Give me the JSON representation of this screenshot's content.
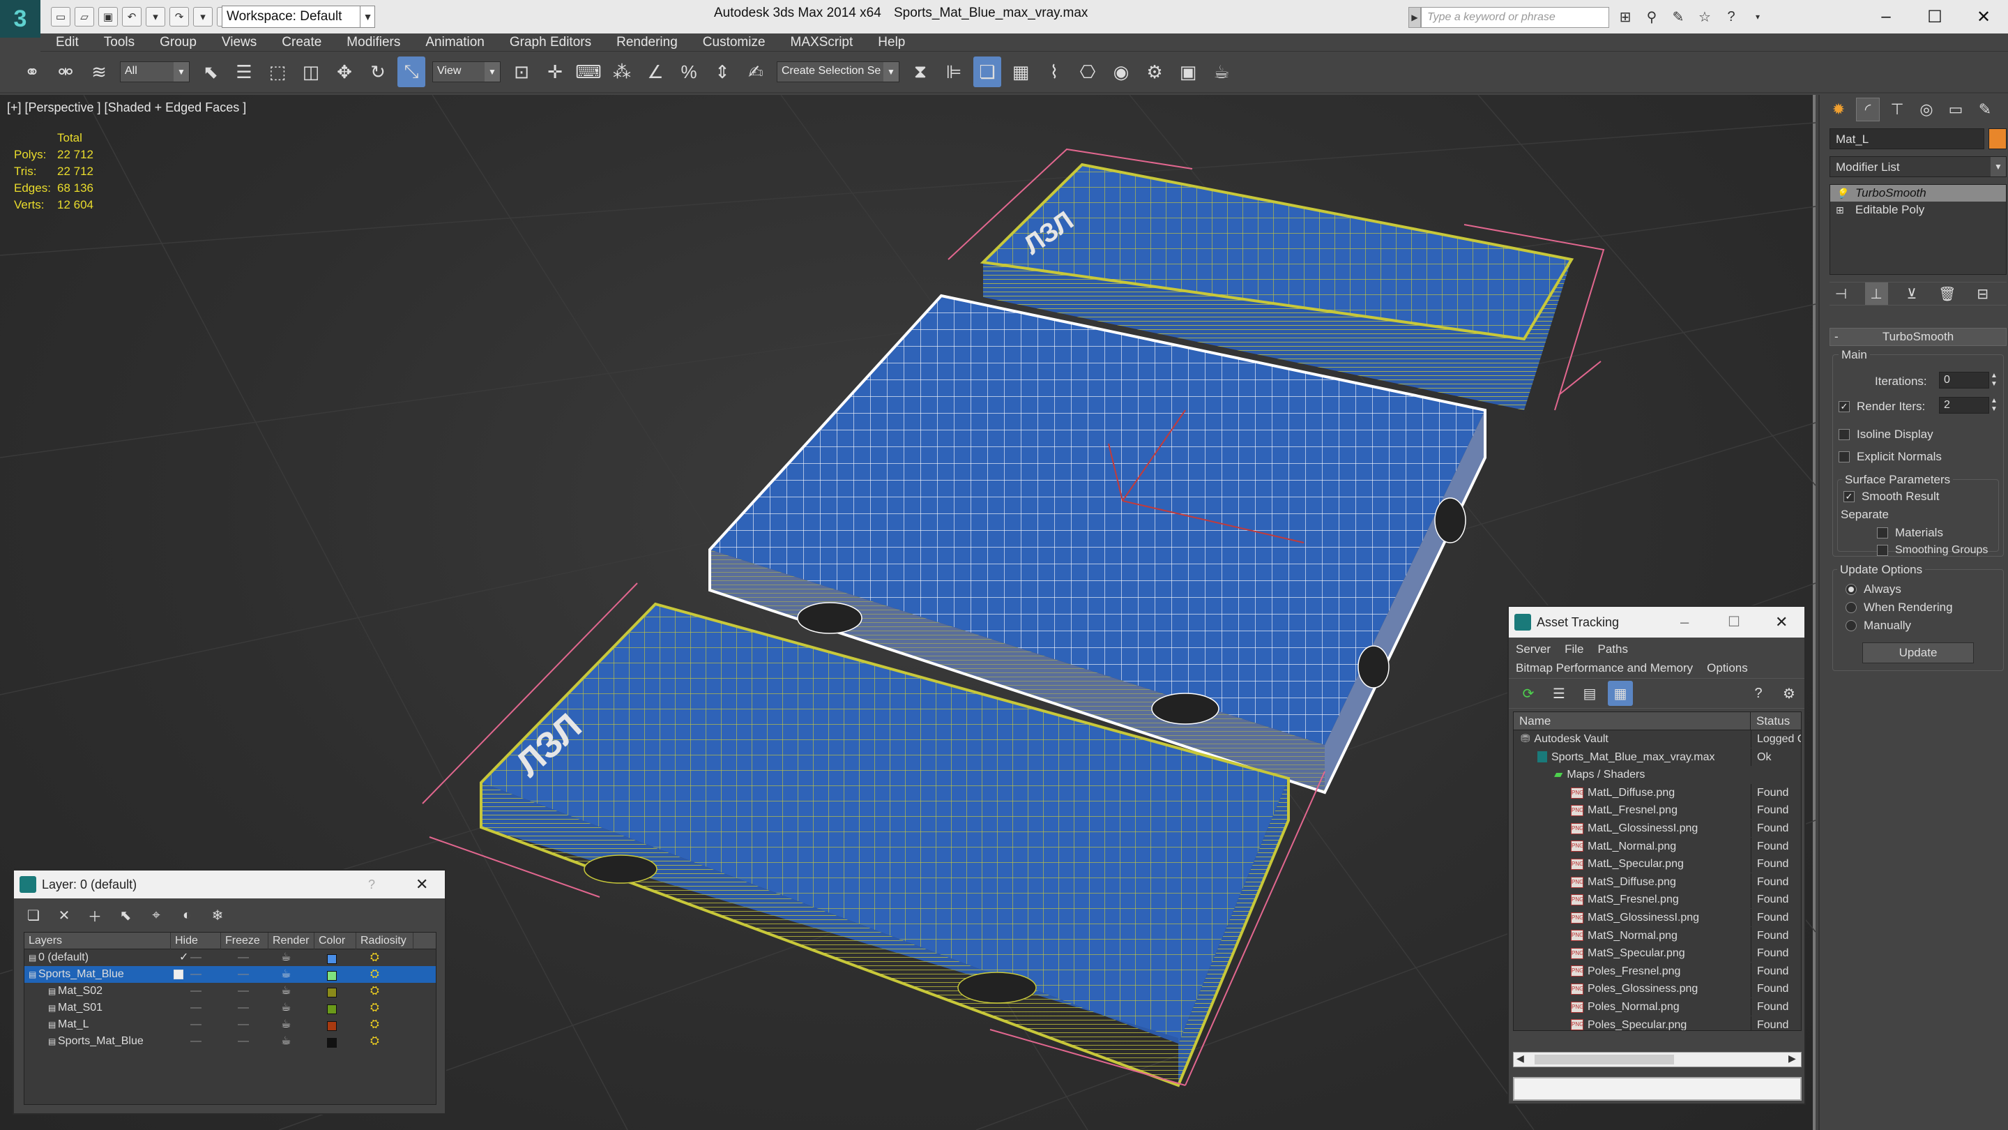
{
  "titlebar": {
    "app_title": "Autodesk 3ds Max  2014 x64",
    "file_title": "Sports_Mat_Blue_max_vray.max",
    "workspace": "Workspace: Default",
    "search_placeholder": "Type a keyword or phrase"
  },
  "menu": [
    "Edit",
    "Tools",
    "Group",
    "Views",
    "Create",
    "Modifiers",
    "Animation",
    "Graph Editors",
    "Rendering",
    "Customize",
    "MAXScript",
    "Help"
  ],
  "toolbar": {
    "filter_dropdown": "All",
    "refcoord_dropdown": "View",
    "selection_set": "Create Selection Se"
  },
  "viewport": {
    "label": "[+] [Perspective ] [Shaded + Edged Faces ]",
    "stats_header": "Total",
    "stats": [
      {
        "key": "Polys:",
        "value": "22 712"
      },
      {
        "key": "Tris:",
        "value": "22 712"
      },
      {
        "key": "Edges:",
        "value": "68 136"
      },
      {
        "key": "Verts:",
        "value": "12 604"
      }
    ]
  },
  "command_panel": {
    "object_name": "Mat_L",
    "object_color": "#e8862a",
    "modifier_list": "Modifier List",
    "stack": [
      "TurboSmooth",
      "Editable Poly"
    ],
    "rollout_title": "TurboSmooth",
    "main_group": "Main",
    "iterations_label": "Iterations:",
    "iterations_value": "0",
    "render_iters_label": "Render Iters:",
    "render_iters_value": "2",
    "isoline_label": "Isoline Display",
    "explicit_normals_label": "Explicit Normals",
    "surface_group": "Surface Parameters",
    "smooth_result_label": "Smooth Result",
    "separate_label": "Separate",
    "materials_label": "Materials",
    "smoothing_groups_label": "Smoothing Groups",
    "update_group": "Update Options",
    "always_label": "Always",
    "when_rendering_label": "When Rendering",
    "manually_label": "Manually",
    "update_button": "Update"
  },
  "layer_window": {
    "title": "Layer: 0 (default)",
    "help": "?",
    "columns": [
      "Layers",
      "Hide",
      "Freeze",
      "Render",
      "Color",
      "Radiosity"
    ],
    "rows": [
      {
        "name": "0 (default)",
        "color": "#4a8fe8",
        "indent": 0,
        "current": true,
        "selected": false
      },
      {
        "name": "Sports_Mat_Blue",
        "color": "#7fe27f",
        "indent": 0,
        "current": false,
        "selected": true
      },
      {
        "name": "Mat_S02",
        "color": "#8a8a1a",
        "indent": 1,
        "current": false,
        "selected": false
      },
      {
        "name": "Mat_S01",
        "color": "#6a9a1a",
        "indent": 1,
        "current": false,
        "selected": false
      },
      {
        "name": "Mat_L",
        "color": "#a83a10",
        "indent": 1,
        "current": false,
        "selected": false
      },
      {
        "name": "Sports_Mat_Blue",
        "color": "#111111",
        "indent": 1,
        "current": false,
        "selected": false
      }
    ]
  },
  "asset_window": {
    "title": "Asset Tracking",
    "menu": [
      "Server",
      "File",
      "Paths"
    ],
    "menu2": [
      "Bitmap Performance and Memory",
      "Options"
    ],
    "columns": [
      "Name",
      "Status"
    ],
    "rows": [
      {
        "name": "Autodesk Vault",
        "status": "Logged Out",
        "indent": 0,
        "type": "vault"
      },
      {
        "name": "Sports_Mat_Blue_max_vray.max",
        "status": "Ok",
        "indent": 1,
        "type": "max"
      },
      {
        "name": "Maps / Shaders",
        "status": "",
        "indent": 2,
        "type": "folder"
      },
      {
        "name": "MatL_Diffuse.png",
        "status": "Found",
        "indent": 3,
        "type": "png"
      },
      {
        "name": "MatL_Fresnel.png",
        "status": "Found",
        "indent": 3,
        "type": "png"
      },
      {
        "name": "MatL_GlossinessI.png",
        "status": "Found",
        "indent": 3,
        "type": "png"
      },
      {
        "name": "MatL_Normal.png",
        "status": "Found",
        "indent": 3,
        "type": "png"
      },
      {
        "name": "MatL_Specular.png",
        "status": "Found",
        "indent": 3,
        "type": "png"
      },
      {
        "name": "MatS_Diffuse.png",
        "status": "Found",
        "indent": 3,
        "type": "png"
      },
      {
        "name": "MatS_Fresnel.png",
        "status": "Found",
        "indent": 3,
        "type": "png"
      },
      {
        "name": "MatS_GlossinessI.png",
        "status": "Found",
        "indent": 3,
        "type": "png"
      },
      {
        "name": "MatS_Normal.png",
        "status": "Found",
        "indent": 3,
        "type": "png"
      },
      {
        "name": "MatS_Specular.png",
        "status": "Found",
        "indent": 3,
        "type": "png"
      },
      {
        "name": "Poles_Fresnel.png",
        "status": "Found",
        "indent": 3,
        "type": "png"
      },
      {
        "name": "Poles_Glossiness.png",
        "status": "Found",
        "indent": 3,
        "type": "png"
      },
      {
        "name": "Poles_Normal.png",
        "status": "Found",
        "indent": 3,
        "type": "png"
      },
      {
        "name": "Poles_Specular.png",
        "status": "Found",
        "indent": 3,
        "type": "png"
      }
    ]
  },
  "colors": {
    "mat_blue": "#2f63b8",
    "wire_yellow": "#c8c83a",
    "selected_wire": "#ffffff",
    "bbox_pink": "#e2678f",
    "stats_yellow": "#eadc2c",
    "selection_blue": "#1f64b8"
  }
}
